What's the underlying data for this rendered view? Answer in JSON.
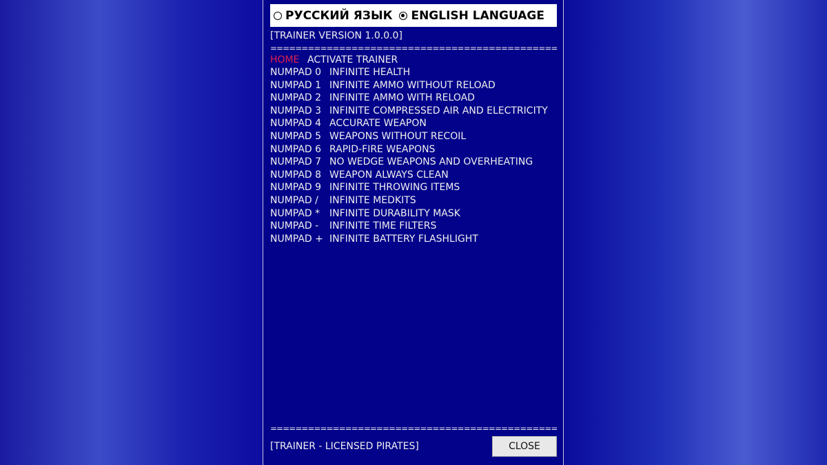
{
  "language": {
    "options": [
      {
        "label": "РУССКИЙ ЯЗЫК",
        "selected": false
      },
      {
        "label": "ENGLISH LANGUAGE",
        "selected": true
      }
    ]
  },
  "version": "[TRAINER VERSION 1.0.0.0]",
  "separator": "==============================================================",
  "home": {
    "key": "HOME",
    "label": "ACTIVATE TRAINER"
  },
  "hotkeys": [
    {
      "key": "NUMPAD 0",
      "label": "INFINITE HEALTH"
    },
    {
      "key": "NUMPAD 1",
      "label": "INFINITE AMMO WITHOUT RELOAD"
    },
    {
      "key": "NUMPAD 2",
      "label": "INFINITE AMMO WITH RELOAD"
    },
    {
      "key": "NUMPAD 3",
      "label": "INFINITE COMPRESSED AIR AND ELECTRICITY"
    },
    {
      "key": "NUMPAD 4",
      "label": "ACCURATE WEAPON"
    },
    {
      "key": "NUMPAD 5",
      "label": "WEAPONS WITHOUT RECOIL"
    },
    {
      "key": "NUMPAD 6",
      "label": "RAPID-FIRE WEAPONS"
    },
    {
      "key": "NUMPAD 7",
      "label": "NO WEDGE WEAPONS AND OVERHEATING"
    },
    {
      "key": "NUMPAD 8",
      "label": "WEAPON ALWAYS CLEAN"
    },
    {
      "key": "NUMPAD 9",
      "label": "INFINITE THROWING ITEMS"
    },
    {
      "key": "NUMPAD /",
      "label": "INFINITE MEDKITS"
    },
    {
      "key": "NUMPAD *",
      "label": "INFINITE DURABILITY MASK"
    },
    {
      "key": "NUMPAD -",
      "label": "INFINITE TIME FILTERS"
    },
    {
      "key": "NUMPAD +",
      "label": "INFINITE BATTERY FLASHLIGHT"
    }
  ],
  "footer": "[TRAINER - LICENSED PIRATES]",
  "close_label": "CLOSE",
  "colors": {
    "window": "#02028a",
    "home_key": "#e0204a"
  }
}
